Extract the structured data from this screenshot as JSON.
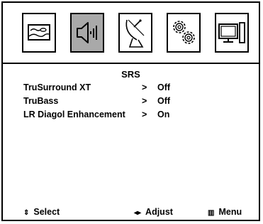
{
  "tabs": [
    {
      "name": "picture-icon",
      "selected": false
    },
    {
      "name": "sound-icon",
      "selected": true
    },
    {
      "name": "channel-antenna-icon",
      "selected": false
    },
    {
      "name": "setup-gears-icon",
      "selected": false
    },
    {
      "name": "input-pc-icon",
      "selected": false
    }
  ],
  "menu": {
    "title": "SRS",
    "items": [
      {
        "label": "TruSurround XT",
        "arrow": ">",
        "value": "Off"
      },
      {
        "label": "TruBass",
        "arrow": ">",
        "value": "Off"
      },
      {
        "label": "LR Diagol Enhancement",
        "arrow": ">",
        "value": "On"
      }
    ]
  },
  "footer": {
    "select_icon": "⇕",
    "select_label": "Select",
    "adjust_icon": "◂▸",
    "adjust_label": "Adjust",
    "menu_icon": "▥",
    "menu_label": "Menu"
  },
  "colors": {
    "selected_tab": "#a9a9a9",
    "border": "#000000"
  }
}
